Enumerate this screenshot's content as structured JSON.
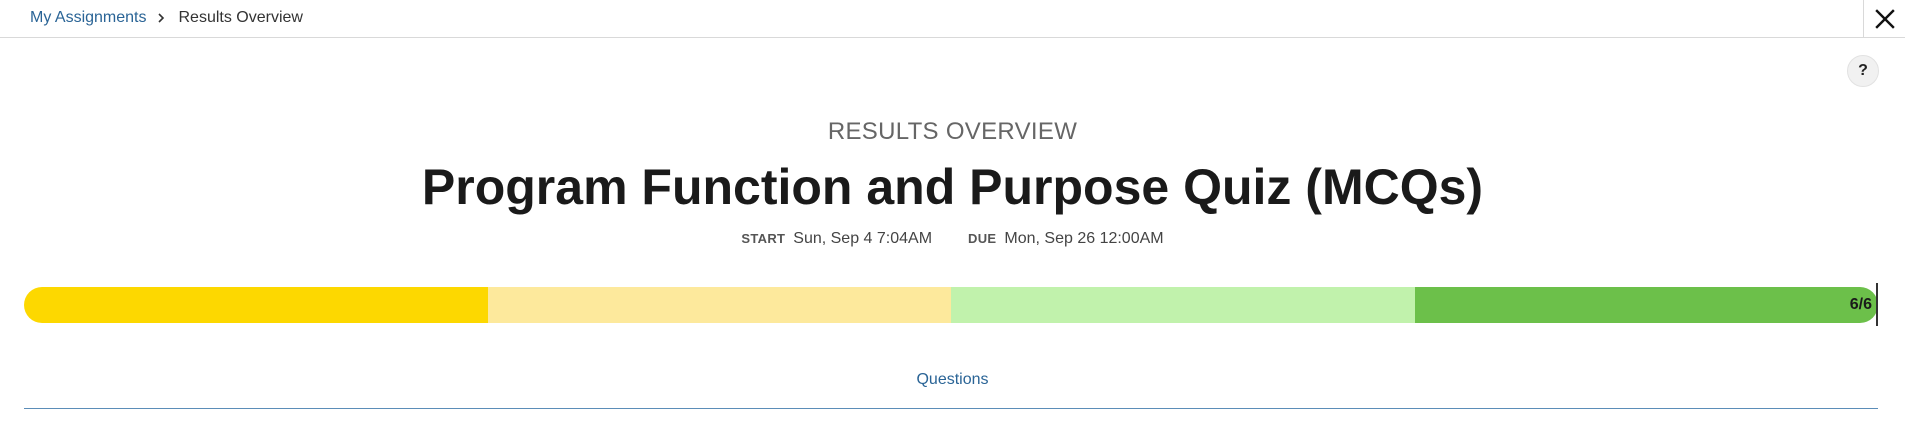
{
  "breadcrumb": {
    "parent_label": "My Assignments",
    "separator_icon": "chevron-right-icon",
    "current_label": "Results Overview"
  },
  "header": {
    "close_icon": "close-icon",
    "help_label": "?"
  },
  "overview": {
    "section_label": "RESULTS OVERVIEW",
    "title": "Program Function and Purpose Quiz (MCQs)",
    "start_key": "START",
    "start_value": "Sun, Sep 4 7:04AM",
    "due_key": "DUE",
    "due_value": "Mon, Sep 26 12:00AM"
  },
  "progress": {
    "score_label": "6/6",
    "score": 6,
    "total": 6,
    "segment_colors": [
      "#fdd800",
      "#fde99c",
      "#c1f2ac",
      "#6cc04a"
    ]
  },
  "tabs": {
    "questions_label": "Questions"
  }
}
